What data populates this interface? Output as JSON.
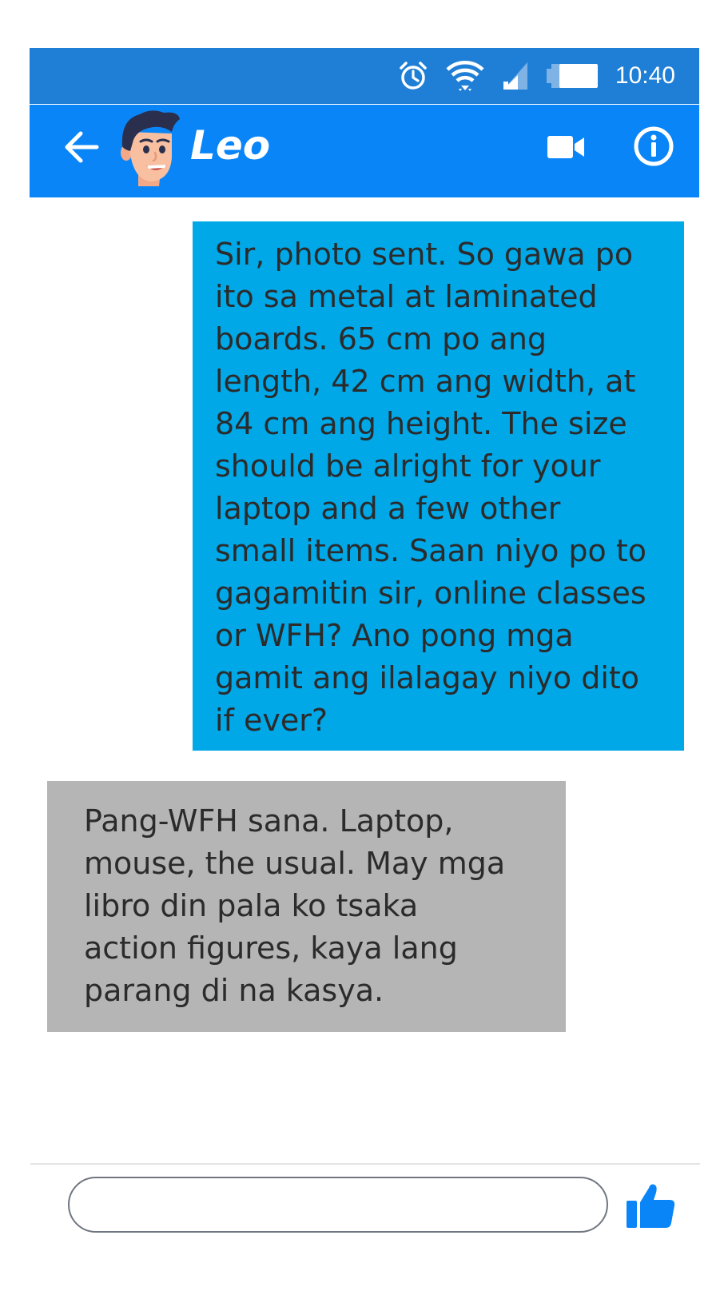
{
  "status_bar": {
    "time": "10:40",
    "icons": [
      "alarm-icon",
      "wifi-icon",
      "signal-icon",
      "battery-icon"
    ]
  },
  "header": {
    "contact_name": "Leo",
    "icons": [
      "back-arrow-icon",
      "avatar",
      "video-camera-icon",
      "info-icon"
    ]
  },
  "messages": [
    {
      "direction": "outgoing",
      "lines": [
        "Sir, photo sent. So gawa po",
        "ito sa metal at laminated",
        "boards. 65 cm po ang",
        "length, 42 cm ang width, at",
        "84 cm ang height. The size",
        "should be alright for your",
        "laptop and a few other",
        "small items. Saan niyo po to",
        "gagamitin sir, online classes",
        "or WFH? Ano pong mga",
        "gamit ang ilalagay niyo dito",
        "if ever?"
      ]
    },
    {
      "direction": "incoming",
      "lines": [
        "Pang-WFH sana. Laptop,",
        "mouse, the usual. May mga",
        "libro din pala ko tsaka",
        "action figures, kaya lang",
        "parang di na kasya."
      ]
    }
  ],
  "composer": {
    "input_value": "",
    "like_icon": "thumbs-up-icon"
  },
  "colors": {
    "status_bar": "#1f7fd6",
    "header": "#0a85f7",
    "outgoing_bubble": "#00a8e8",
    "incoming_bubble": "#b5b5b5",
    "like_icon": "#0a85f7"
  }
}
